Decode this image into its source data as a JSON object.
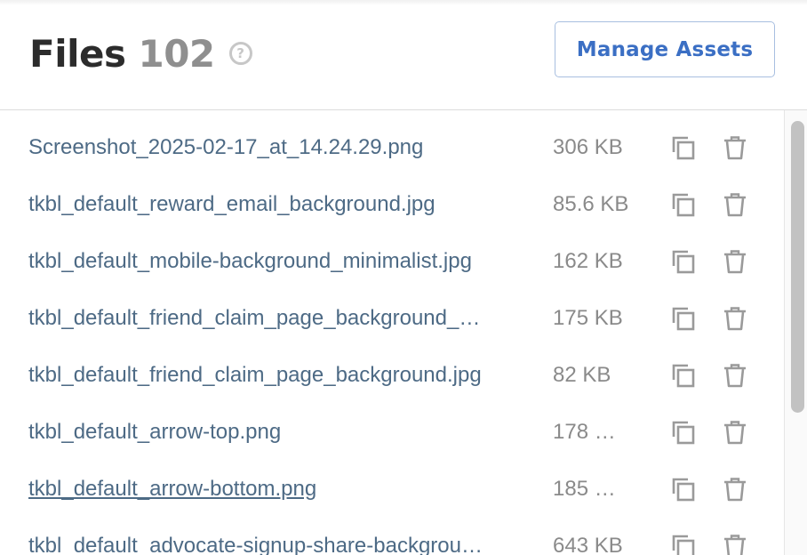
{
  "header": {
    "title": "Files",
    "count": "102",
    "help_glyph": "?",
    "manage_button_label": "Manage Assets"
  },
  "files": [
    {
      "name": "Screenshot_2025-02-17_at_14.24.29.png",
      "size": "306 KB"
    },
    {
      "name": "tkbl_default_reward_email_background.jpg",
      "size": "85.6 KB"
    },
    {
      "name": "tkbl_default_mobile-background_minimalist.jpg",
      "size": "162 KB"
    },
    {
      "name": "tkbl_default_friend_claim_page_background_…",
      "size": "175 KB"
    },
    {
      "name": "tkbl_default_friend_claim_page_background.jpg",
      "size": "82 KB"
    },
    {
      "name": "tkbl_default_arrow-top.png",
      "size": "178 …"
    },
    {
      "name": "tkbl_default_arrow-bottom.png",
      "size": "185 …"
    },
    {
      "name": "tkbl_default_advocate-signup-share-backgrou…",
      "size": "643 KB"
    }
  ],
  "icons": {
    "copy": "copy-icon",
    "delete": "trash-icon",
    "help": "help-icon"
  },
  "colors": {
    "link": "#4d6a85",
    "accent": "#3b6fc4",
    "muted": "#8a8a8a",
    "icon": "#9a9a9a"
  }
}
